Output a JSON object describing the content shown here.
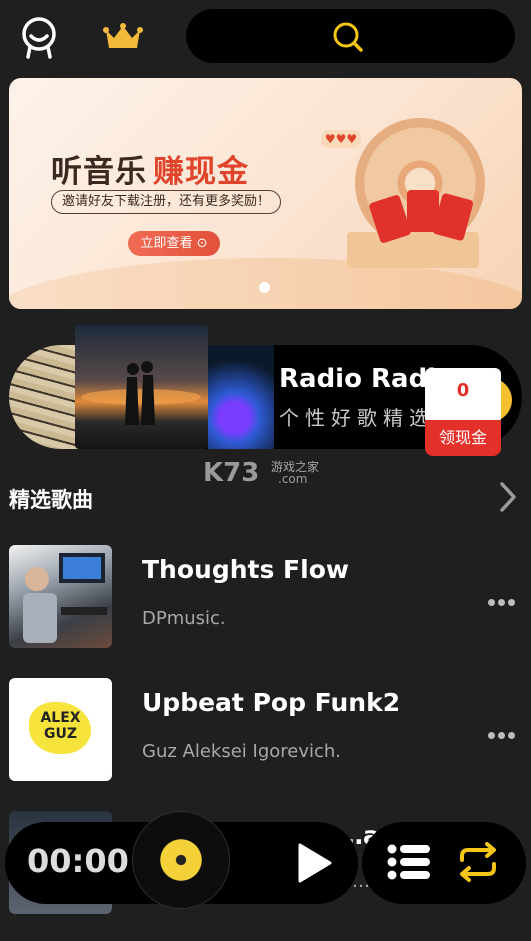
{
  "topbar": {
    "avatar_icon": "user-face-icon",
    "vip_icon": "crown-icon",
    "search_icon": "search-icon",
    "accent": "#f5c518"
  },
  "banner": {
    "title_part1": "听音乐",
    "title_part2": "赚现金",
    "subtitle": "邀请好友下载注册，还有更多奖励！",
    "cta": "立即查看 ⊙",
    "page_index": 1,
    "page_count": 1
  },
  "radio": {
    "title": "Radio Radio",
    "subtitle": "个性好歌精选"
  },
  "coin_widget": {
    "count": "0",
    "label": "领现金"
  },
  "watermark": {
    "brand": "K73",
    "cn": "游戏之家",
    "domain": ".com"
  },
  "section": {
    "title": "精选歌曲",
    "more_icon": "chevron-right-icon"
  },
  "songs": [
    {
      "title": "Thoughts Flow",
      "artist": "DPmusic."
    },
    {
      "title": "Upbeat Pop Funk2",
      "artist": "Guz Aleksei Igorevich.",
      "art_text": "ALEX\nGUZ"
    },
    {
      "title": "…ar",
      "artist": "…N…"
    }
  ],
  "player": {
    "time": "00:00",
    "play_icon": "play-icon",
    "playlist_icon": "playlist-icon",
    "repeat_icon": "repeat-icon"
  }
}
